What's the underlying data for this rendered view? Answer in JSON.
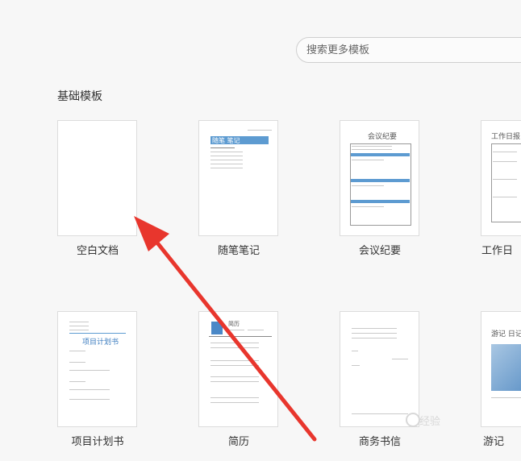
{
  "search": {
    "placeholder": "搜索更多模板"
  },
  "section": {
    "title": "基础模板"
  },
  "templates": [
    {
      "label": "空白文档"
    },
    {
      "label": "随笔笔记",
      "preview_title": "随笔 笔记"
    },
    {
      "label": "会议纪要",
      "preview_title": "会议纪要"
    },
    {
      "label": "工作日",
      "preview_title": "工作日报"
    },
    {
      "label": "项目计划书",
      "preview_title": "项目计划书"
    },
    {
      "label": "简历",
      "preview_title": "简历"
    },
    {
      "label": "商务书信"
    },
    {
      "label": "游记",
      "preview_title": "游记 日记"
    }
  ],
  "watermark": {
    "text": "经验"
  },
  "colors": {
    "accent_blue": "#5d9bd1",
    "arrow_red": "#e8362d"
  }
}
